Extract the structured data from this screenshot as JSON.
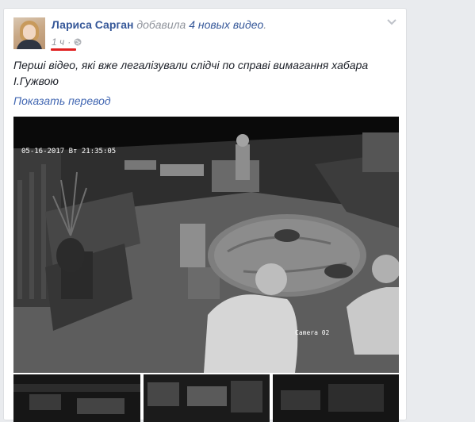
{
  "post": {
    "author": "Лариса Сарган",
    "action_prefix": "добавила",
    "action_link": "4 новых видео",
    "action_suffix": ".",
    "timestamp": "1 ч",
    "privacy_icon": "globe-icon",
    "menu_icon": "chevron-down-icon",
    "text": "Перші відео, які вже легалізували слідчі по справі вимагання хабара І.Гужвою",
    "translate_label": "Показать перевод"
  },
  "video": {
    "timestamp_overlay": "05-16-2017 Вт 21:35:05",
    "camera_label": "Camera 02"
  },
  "colors": {
    "link": "#365899",
    "meta": "#90949c",
    "underline": "#e02020",
    "background": "#e9ebee"
  }
}
